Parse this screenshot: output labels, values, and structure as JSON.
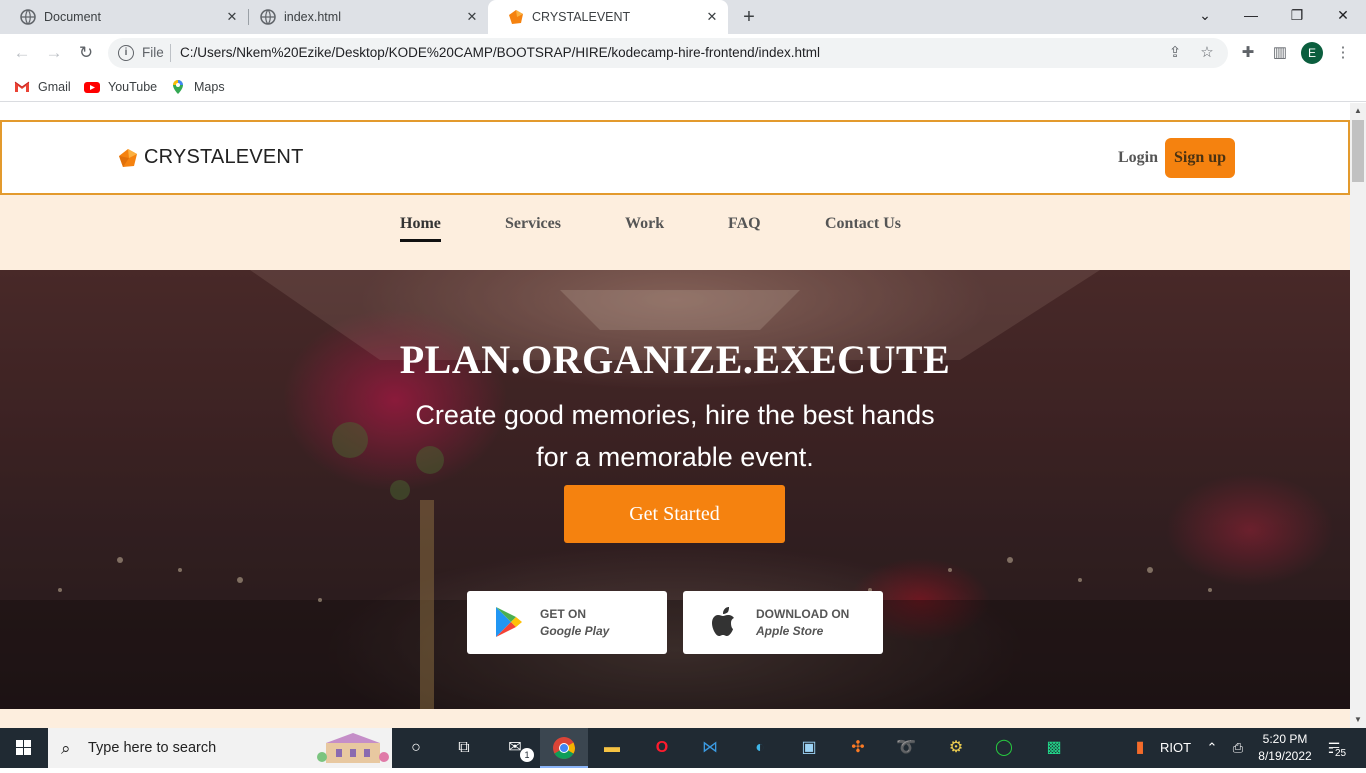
{
  "browser": {
    "tabs": [
      {
        "title": "Document"
      },
      {
        "title": "index.html"
      },
      {
        "title": "CRYSTALEVENT"
      }
    ],
    "omnibox": {
      "scheme_label": "File",
      "url": "C:/Users/Nkem%20Ezike/Desktop/KODE%20CAMP/BOOTSRAP/HIRE/kodecamp-hire-frontend/index.html"
    },
    "profile_initial": "E",
    "bookmarks": [
      {
        "label": "Gmail"
      },
      {
        "label": "YouTube"
      },
      {
        "label": "Maps"
      }
    ]
  },
  "site": {
    "brand": "CRYSTALEVENT",
    "login_label": "Login",
    "signup_label": "Sign up",
    "accent_color": "#f5820f",
    "nav": [
      {
        "label": "Home",
        "active": true
      },
      {
        "label": "Services"
      },
      {
        "label": "Work"
      },
      {
        "label": "FAQ"
      },
      {
        "label": "Contact Us"
      }
    ],
    "hero": {
      "title": "PLAN.ORGANIZE.EXECUTE",
      "subtitle_line1": "Create good memories, hire the best hands",
      "subtitle_line2": "for a memorable event.",
      "cta_label": "Get Started",
      "google_play": {
        "line1": "GET ON",
        "line2": "Google Play"
      },
      "apple_store": {
        "line1": "DOWNLOAD ON",
        "line2": "Apple Store"
      }
    }
  },
  "taskbar": {
    "search_placeholder": "Type here to search",
    "mail_badge": "1",
    "tray_label": "RIOT",
    "time": "5:20 PM",
    "date": "8/19/2022",
    "notification_count": "25"
  }
}
